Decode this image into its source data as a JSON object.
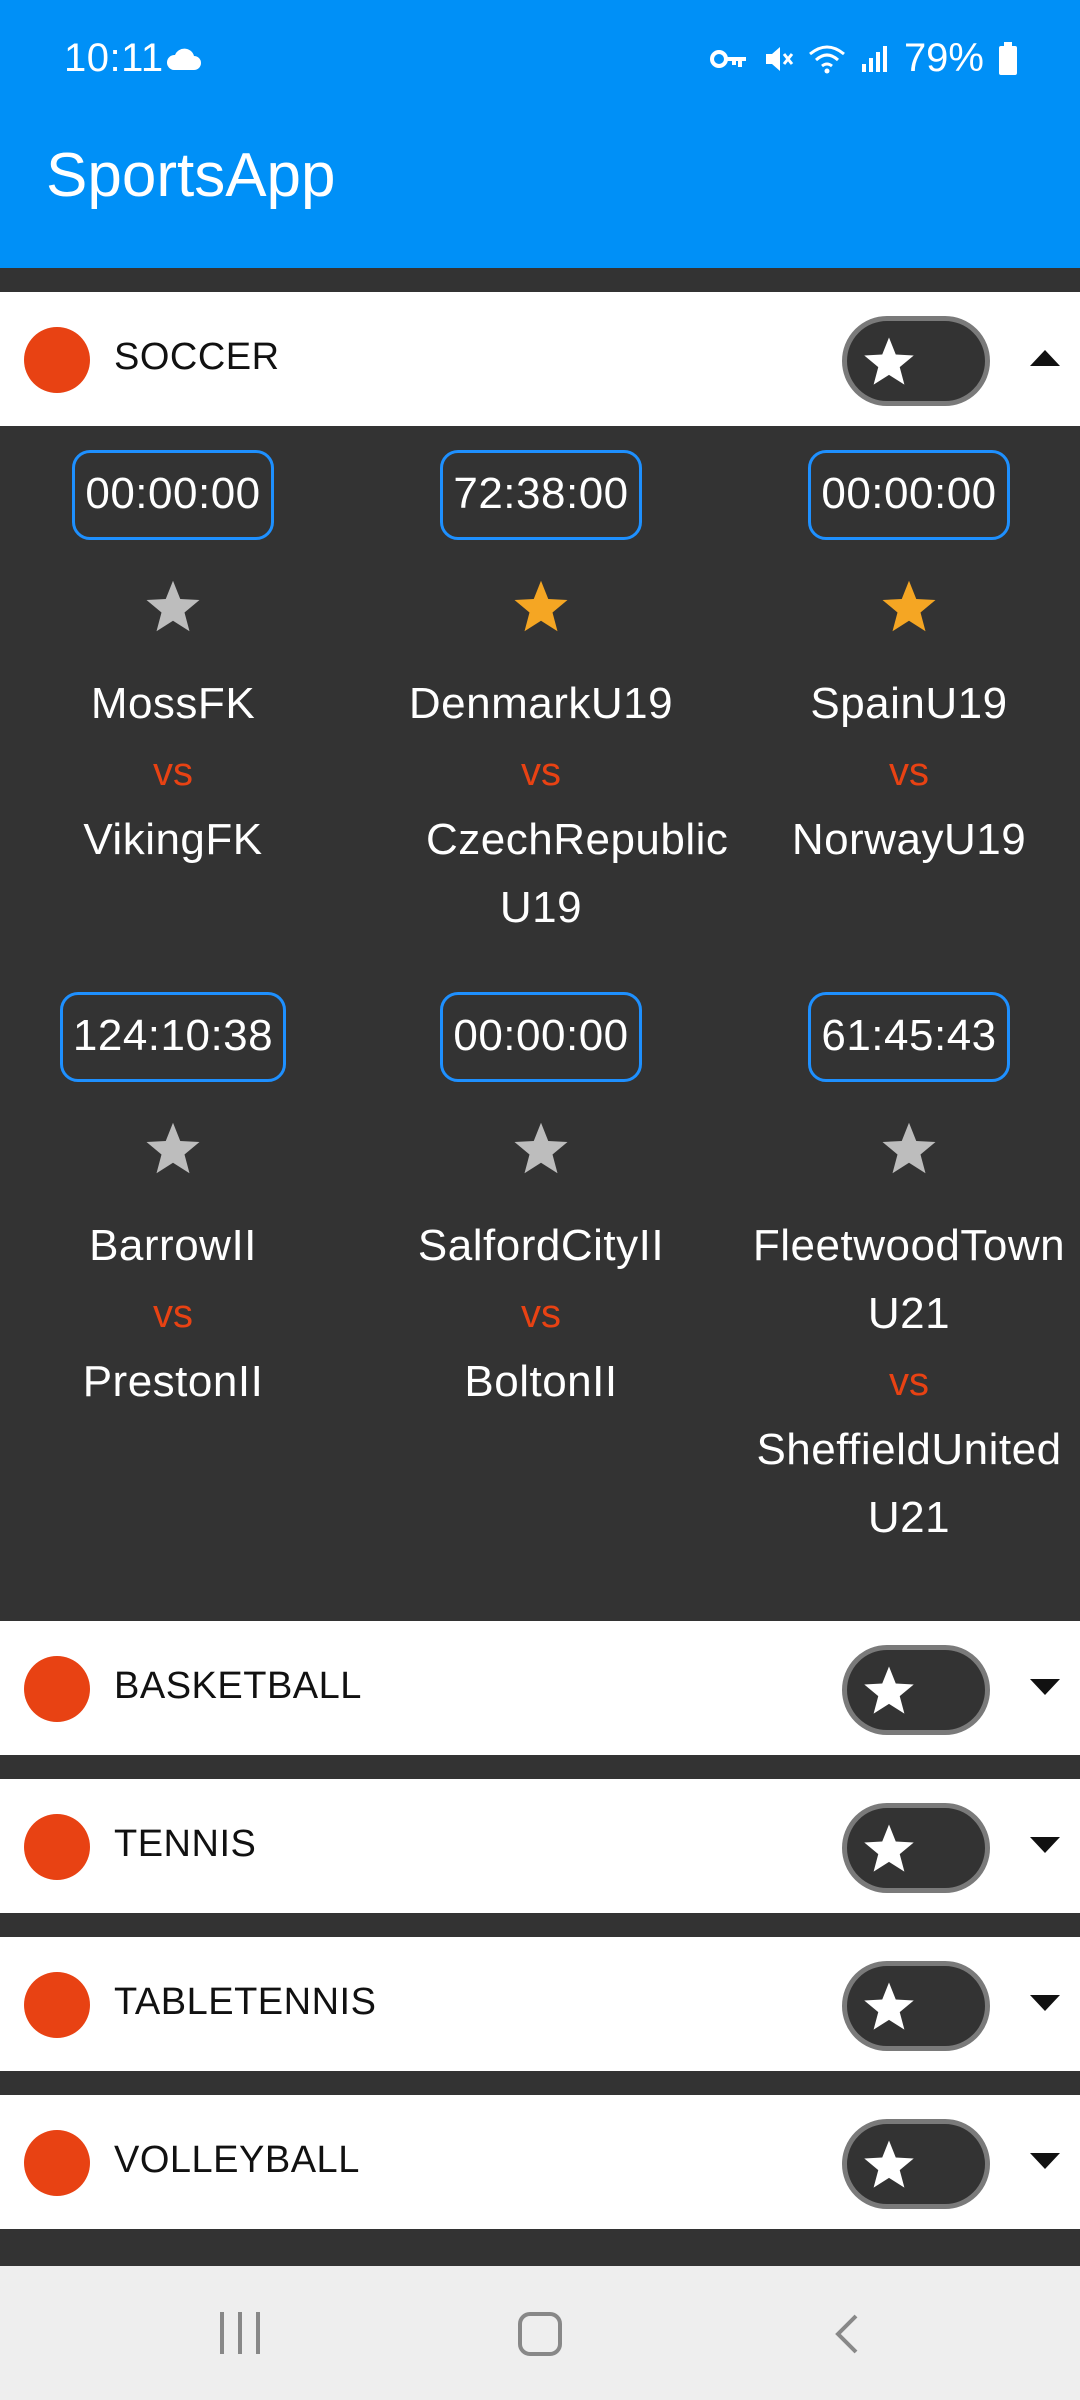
{
  "status_bar": {
    "time": "10:11",
    "battery": "79%"
  },
  "app_title": "SportsApp",
  "colors": {
    "app_bar": "#0090F7",
    "accent_dot": "#E84213",
    "vs_text": "#E84213",
    "timer_border": "#1E90FF",
    "fav_star": "#F5A623",
    "inactive_star": "#BDBDBD",
    "panel_bg": "#333333"
  },
  "sections": [
    {
      "title": "SOCCER",
      "expanded": true
    },
    {
      "title": "BASKETBALL",
      "expanded": false
    },
    {
      "title": "TENNIS",
      "expanded": false
    },
    {
      "title": "TABLETENNIS",
      "expanded": false
    },
    {
      "title": "VOLLEYBALL",
      "expanded": false
    }
  ],
  "matches": [
    {
      "timer": "00:00:00",
      "favorite": false,
      "home": "MossFK",
      "vs": "vs",
      "away": "VikingFK"
    },
    {
      "timer": "72:38:00",
      "favorite": true,
      "home": "DenmarkU19",
      "vs": "vs",
      "away": "CzechRepublic U19"
    },
    {
      "timer": "00:00:00",
      "favorite": true,
      "home": "SpainU19",
      "vs": "vs",
      "away": "NorwayU19"
    },
    {
      "timer": "124:10:38",
      "favorite": false,
      "home": "BarrowII",
      "vs": "vs",
      "away": "PrestonII"
    },
    {
      "timer": "00:00:00",
      "favorite": false,
      "home": "SalfordCityII",
      "vs": "vs",
      "away": "BoltonII"
    },
    {
      "timer": "61:45:43",
      "favorite": false,
      "home": "FleetwoodTown U21",
      "vs": "vs",
      "away": "SheffieldUnited U21"
    }
  ]
}
